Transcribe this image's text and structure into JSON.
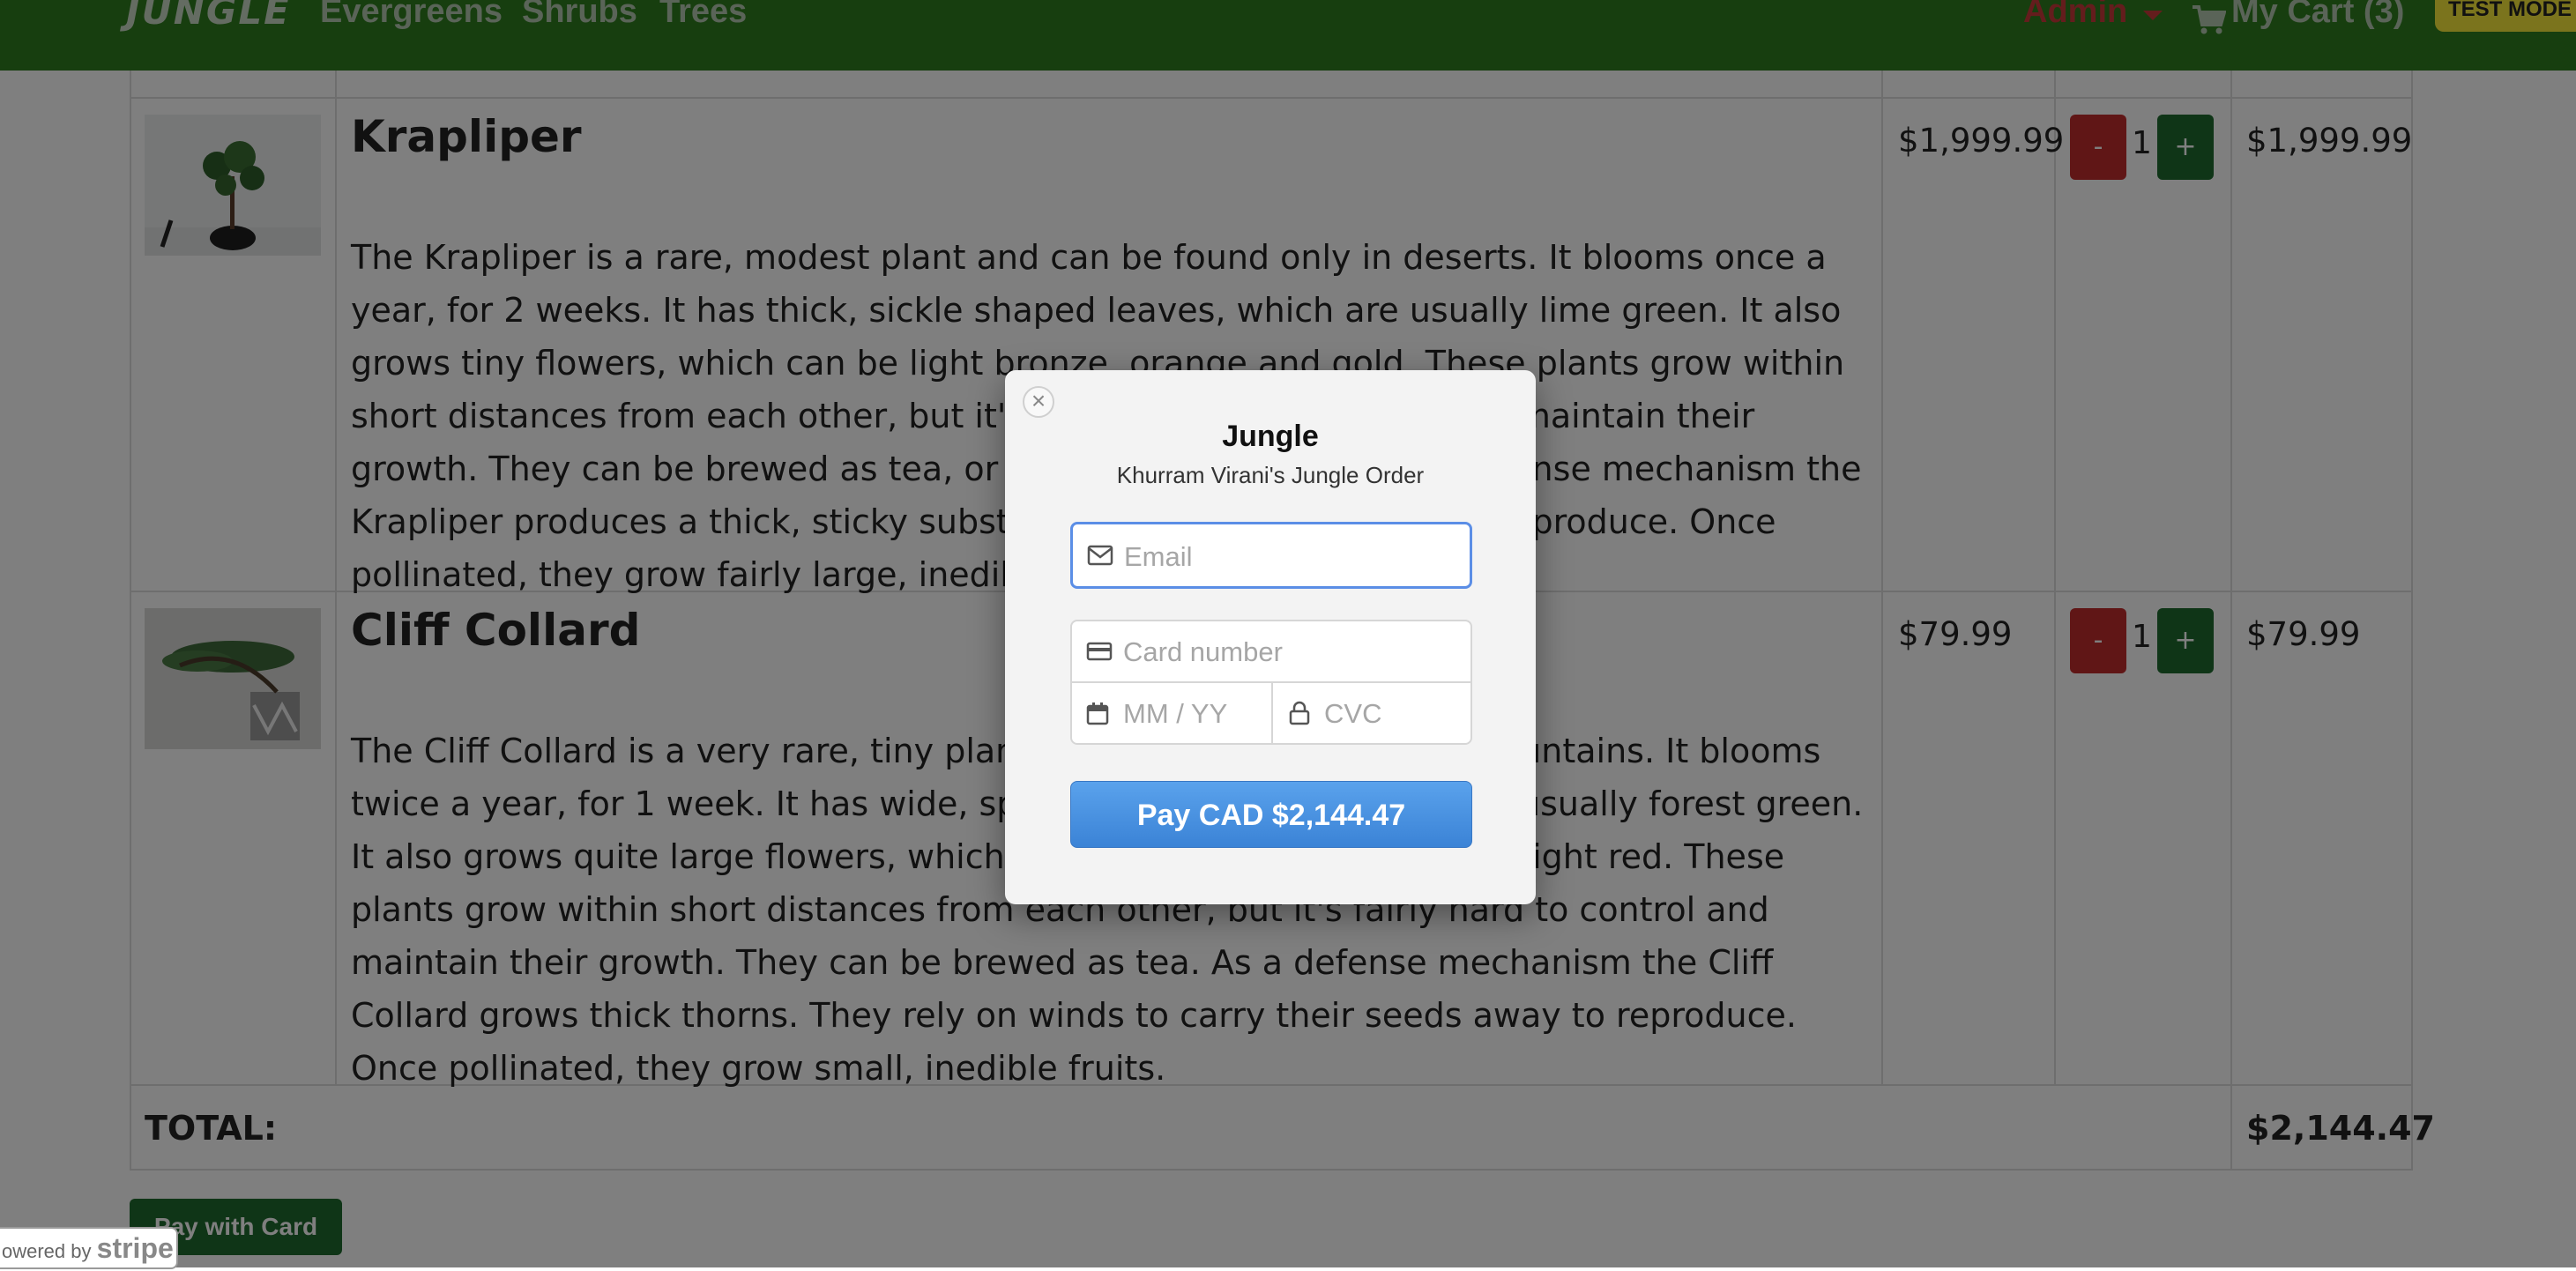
{
  "navbar": {
    "brand": "JUNGLE",
    "links": [
      "Evergreens",
      "Shrubs",
      "Trees"
    ],
    "admin_label": "Admin",
    "cart_label": "My Cart (3)",
    "test_mode": "TEST MODE"
  },
  "products": [
    {
      "name": "Krapliper",
      "description": "The Krapliper is a rare, modest plant and can be found only in deserts. It blooms once a year, for 2 weeks. It has thick, sickle shaped leaves, which are usually lime green. It also grows tiny flowers, which can be light bronze, orange and gold. These plants grow within short distances from each other, but it's really difficult to control and maintain their growth. They can be brewed as tea, or used as anti-wounds. As a defense mechanism the Krapliper produces a thick, sticky substance. It relies on the wind to reproduce. Once pollinated, they grow fairly large, inedible fruits.",
      "price": "$1,999.99",
      "quantity": "1",
      "subtotal": "$1,999.99"
    },
    {
      "name": "Cliff Collard",
      "description": "The Cliff Collard is a very rare, tiny plant and can be found only in mountains. It blooms twice a year, for 1 week. It has wide, spear shaped leaves, which are usually forest green. It also grows quite large flowers, which can be silver, light brown and light red. These plants grow within short distances from each other, but it's fairly hard to control and maintain their growth. They can be brewed as tea. As a defense mechanism the Cliff Collard grows thick thorns. They rely on winds to carry their seeds away to reproduce. Once pollinated, they grow small, inedible fruits.",
      "price": "$79.99",
      "quantity": "1",
      "subtotal": "$79.99"
    }
  ],
  "controls": {
    "minus": "-",
    "plus": "+"
  },
  "totals": {
    "label": "TOTAL:",
    "value": "$2,144.47"
  },
  "pay_with_card": "Pay with Card",
  "powered_by": {
    "prefix": "owered by",
    "brand": "stripe"
  },
  "checkout": {
    "close": "×",
    "title": "Jungle",
    "subtitle": "Khurram Virani's Jungle Order",
    "email_placeholder": "Email",
    "card_placeholder": "Card number",
    "expiry_placeholder": "MM / YY",
    "cvc_placeholder": "CVC",
    "pay_button": "Pay CAD $2,144.47"
  }
}
